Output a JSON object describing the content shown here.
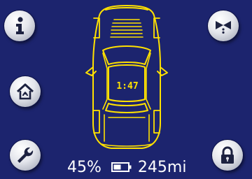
{
  "car": {
    "timer": "1:47",
    "outline_color": "#ffe100"
  },
  "status": {
    "charge_percent": "45%",
    "range": "245mi"
  },
  "buttons": {
    "info": "info-icon",
    "home": "home-icon",
    "wrench": "wrench-icon",
    "fan": "fan-icon",
    "lock": "lock-icon"
  },
  "colors": {
    "background": "#1c246e",
    "accent": "#ffe100",
    "button_face": "#e4e6ec",
    "icon": "#1d2240"
  }
}
